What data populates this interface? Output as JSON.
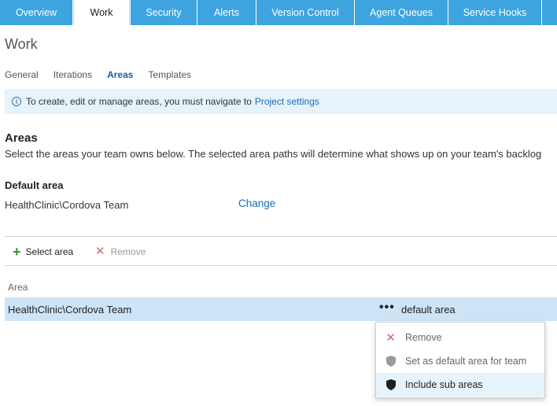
{
  "top_tabs": [
    {
      "label": "Overview",
      "active": false
    },
    {
      "label": "Work",
      "active": true
    },
    {
      "label": "Security",
      "active": false
    },
    {
      "label": "Alerts",
      "active": false
    },
    {
      "label": "Version Control",
      "active": false
    },
    {
      "label": "Agent Queues",
      "active": false
    },
    {
      "label": "Service Hooks",
      "active": false
    }
  ],
  "page_title": "Work",
  "subnav": [
    {
      "label": "General",
      "active": false
    },
    {
      "label": "Iterations",
      "active": false
    },
    {
      "label": "Areas",
      "active": true
    },
    {
      "label": "Templates",
      "active": false
    }
  ],
  "info": {
    "text": "To create, edit or manage areas, you must navigate to",
    "link": "Project settings",
    "icon": "info-icon"
  },
  "areas": {
    "title": "Areas",
    "description": "Select the areas your team owns below. The selected area paths will determine what shows up on your team's backlog"
  },
  "default_area": {
    "label": "Default area",
    "value": "HealthClinic\\Cordova Team",
    "change_label": "Change"
  },
  "toolbar": {
    "select_area_label": "Select area",
    "remove_label": "Remove"
  },
  "table": {
    "column_header": "Area",
    "rows": [
      {
        "area": "HealthClinic\\Cordova Team",
        "more": "•••",
        "tag": "default area",
        "selected": true
      }
    ]
  },
  "context_menu": {
    "items": [
      {
        "label": "Remove",
        "icon": "remove-x-icon"
      },
      {
        "label": "Set as default area for team",
        "icon": "shield-gray-icon"
      },
      {
        "label": "Include sub areas",
        "icon": "shield-dark-icon"
      }
    ]
  },
  "colors": {
    "tab_blue": "#3da4e0",
    "link_blue": "#1e6cb8",
    "selected_row": "#cce4f6",
    "info_bg": "#e6f3fa",
    "add_green": "#2e9a3c",
    "remove_red": "#d06a6a"
  }
}
